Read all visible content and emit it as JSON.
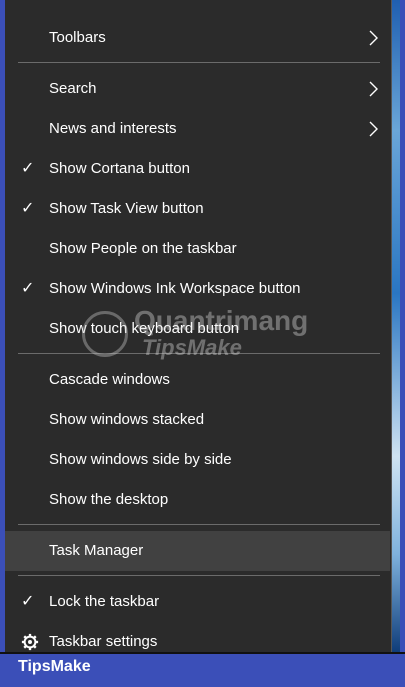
{
  "menu": {
    "toolbars": "Toolbars",
    "search": "Search",
    "news": "News and interests",
    "cortana": "Show Cortana button",
    "taskview": "Show Task View button",
    "people": "Show People on the taskbar",
    "ink": "Show Windows Ink Workspace button",
    "touch": "Show touch keyboard button",
    "cascade": "Cascade windows",
    "stacked": "Show windows stacked",
    "sidebyside": "Show windows side by side",
    "desktop": "Show the desktop",
    "taskmanager": "Task Manager",
    "lock": "Lock the taskbar",
    "settings": "Taskbar settings",
    "check_glyph": "✓"
  },
  "watermark": {
    "line1": "Quantrimang",
    "line2": "TipsMake"
  },
  "brand": "TipsMake",
  "colors": {
    "menu_bg": "#2b2b2b",
    "hover_bg": "#414141",
    "frame": "#3b4fb8",
    "text": "#ffffff"
  }
}
